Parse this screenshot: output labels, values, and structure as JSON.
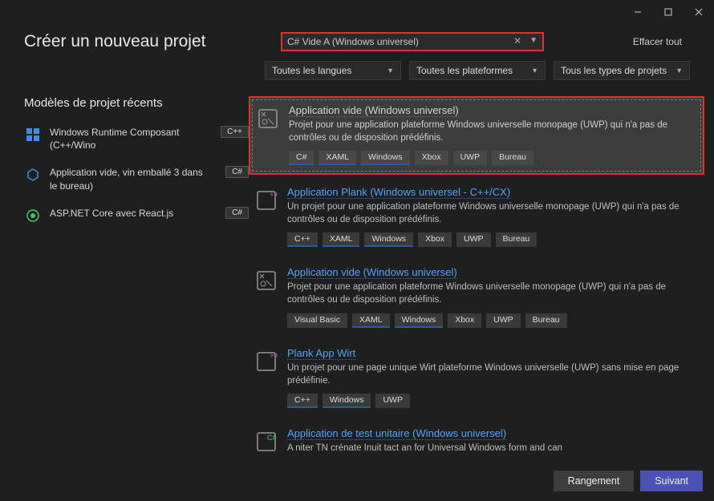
{
  "title": "Créer un nouveau projet",
  "search": {
    "value": "C# Vide A (Windows universel)"
  },
  "clear_all": "Effacer tout",
  "filters": {
    "lang": "Toutes les langues",
    "platform": "Toutes les plateformes",
    "type": "Tous les types de projets"
  },
  "recent": {
    "title": "Modèles de projet récents",
    "items": [
      {
        "name": "Windows Runtime Composant (C++/Wino",
        "tag": "C++"
      },
      {
        "name": "Application vide, vin emballé 3 dans le bureau)",
        "tag": "C#"
      },
      {
        "name": "ASP.NET Core avec React.js",
        "tag": "C#"
      }
    ]
  },
  "templates": [
    {
      "title": "Application vide (Windows universel)",
      "desc": "Projet pour une application plateforme Windows universelle monopage (UWP) qui n'a pas de contrôles ou de disposition prédéfinis.",
      "tags": [
        "C#",
        "XAML",
        "Windows",
        "Xbox",
        "UWP",
        "Bureau"
      ],
      "selected": true
    },
    {
      "title": "Application Plank (Windows universel - C++/CX)",
      "desc": "Un projet pour une application plateforme Windows universelle monopage (UWP) qui n'a pas de contrôles ou de disposition prédéfinis.",
      "tags": [
        "C++",
        "XAML",
        "Windows",
        "Xbox",
        "UWP",
        "Bureau"
      ]
    },
    {
      "title": "Application vide (Windows universel)",
      "desc": "Projet pour une application plateforme Windows universelle monopage (UWP) qui n'a pas de contrôles ou de disposition prédéfinis.",
      "tags": [
        "Visual Basic",
        "XAML",
        "Windows",
        "Xbox",
        "UWP",
        "Bureau"
      ]
    },
    {
      "title": "Plank App Wirt",
      "desc": "Un projet pour une page unique Wirt plateforme Windows universelle (UWP) sans mise en page prédéfinie.",
      "tags": [
        "C++",
        "Windows",
        "UWP"
      ]
    },
    {
      "title": "Application de test unitaire (Windows universel)",
      "desc": "A niter TN crénate Inuit tact an for Universal Windows form and can",
      "tags": []
    }
  ],
  "footer": {
    "back": "Rangement",
    "next": "Suivant"
  }
}
